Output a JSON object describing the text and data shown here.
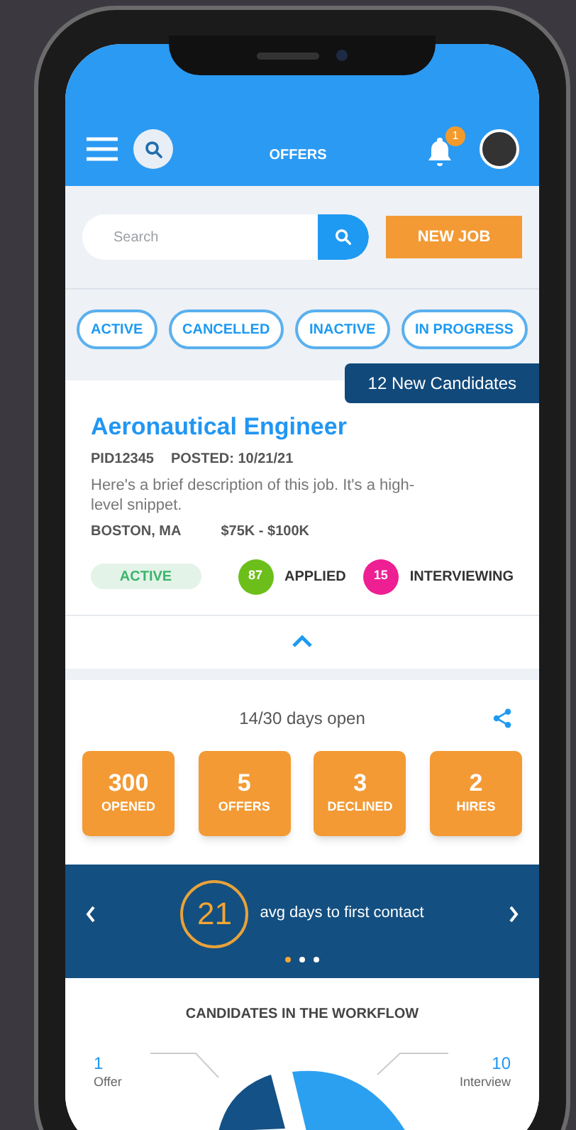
{
  "header": {
    "title": "OFFERS",
    "notification_count": "1"
  },
  "search": {
    "placeholder": "Search"
  },
  "new_job_button": "NEW JOB",
  "filters": [
    {
      "label": "ACTIVE",
      "selected": false
    },
    {
      "label": "CANCELLED",
      "selected": false
    },
    {
      "label": "INACTIVE",
      "selected": false
    },
    {
      "label": "IN PROGRESS",
      "selected": false
    }
  ],
  "job": {
    "new_candidates": "12 New Candidates",
    "title": "Aeronautical Engineer",
    "pid": "PID12345",
    "posted": "POSTED: 10/21/21",
    "description": "Here's a brief description of this job. It's a high-level snippet.",
    "location": "BOSTON, MA",
    "salary": "$75K - $100K",
    "status": "ACTIVE",
    "expanded": true,
    "counts": [
      {
        "value": "87",
        "label": "APPLIED",
        "color": "#6cbf1a"
      },
      {
        "value": "15",
        "label": "INTERVIEWING",
        "color": "#ee1e93"
      }
    ]
  },
  "stats": {
    "days_open": "14/30 days open",
    "tiles": [
      {
        "value": "300",
        "label": "OPENED"
      },
      {
        "value": "5",
        "label": "OFFERS"
      },
      {
        "value": "3",
        "label": "DECLINED"
      },
      {
        "value": "2",
        "label": "HIRES"
      }
    ]
  },
  "carousel": {
    "value": "21",
    "text": "avg days to first contact",
    "dots": [
      {
        "selected": true
      },
      {
        "selected": false
      },
      {
        "selected": false
      }
    ]
  },
  "workflow": {
    "title": "CANDIDATES IN THE WORKFLOW",
    "callouts": [
      {
        "value": "1",
        "label": "Offer"
      },
      {
        "value": "10",
        "label": "Interview"
      }
    ]
  }
}
